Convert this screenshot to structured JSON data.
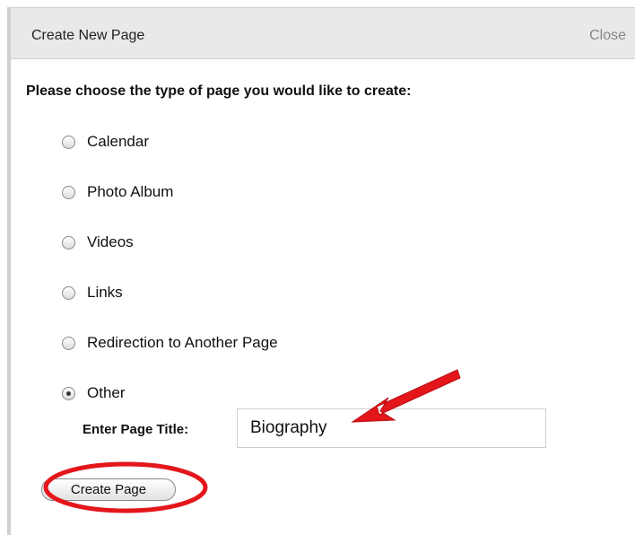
{
  "dialog": {
    "title": "Create New Page",
    "close_label": "Close"
  },
  "prompt": "Please choose the type of page you would like to create:",
  "options": [
    {
      "label": "Calendar",
      "checked": false
    },
    {
      "label": "Photo Album",
      "checked": false
    },
    {
      "label": "Videos",
      "checked": false
    },
    {
      "label": "Links",
      "checked": false
    },
    {
      "label": "Redirection to Another Page",
      "checked": false
    },
    {
      "label": "Other",
      "checked": true
    }
  ],
  "page_title_field": {
    "label": "Enter Page Title:",
    "value": "Biography"
  },
  "create_button_label": "Create Page",
  "annotation_color": "#e3161b"
}
